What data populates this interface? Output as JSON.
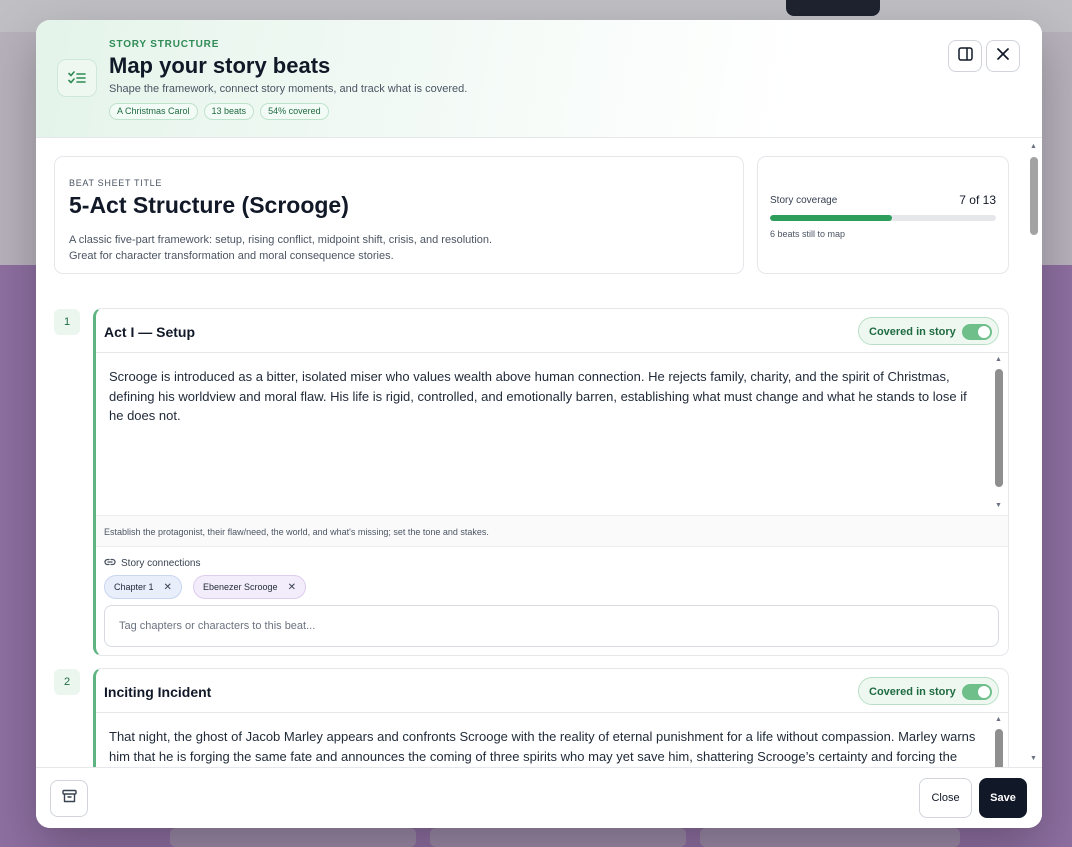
{
  "header": {
    "eyebrow": "STORY STRUCTURE",
    "title": "Map your story beats",
    "subtitle": "Shape the framework, connect story moments, and track what is covered.",
    "chips": [
      "A Christmas Carol",
      "13 beats",
      "54% covered"
    ],
    "icon": "checklist-icon",
    "actions": [
      "panel-layout-icon",
      "close-icon"
    ]
  },
  "sheet": {
    "label": "BEAT SHEET TITLE",
    "title": "5-Act Structure (Scrooge)",
    "description_line1": "A classic five-part framework: setup, rising conflict, midpoint shift, crisis, and resolution.",
    "description_line2": "Great for character transformation and moral consequence stories."
  },
  "coverage": {
    "label": "Story coverage",
    "count": "7 of 13",
    "fraction": 0.54,
    "note": "6 beats still to map"
  },
  "beats": [
    {
      "number": "1",
      "title": "Act I — Setup",
      "covered_label": "Covered in story",
      "covered": true,
      "text": "Scrooge is introduced as a bitter, isolated miser who values wealth above human connection. He rejects family, charity, and the spirit of Christmas, defining his worldview and moral flaw. His life is rigid, controlled, and emotionally barren, establishing what must change and what he stands to lose if he does not.",
      "hint": "Establish the protagonist, their flaw/need, the world, and what's missing; set the tone and stakes.",
      "connections_label": "Story connections",
      "tags": [
        {
          "label": "Chapter 1",
          "kind": "chapter"
        },
        {
          "label": "Ebenezer Scrooge",
          "kind": "character"
        }
      ],
      "tag_placeholder": "Tag chapters or characters to this beat..."
    },
    {
      "number": "2",
      "title": "Inciting Incident",
      "covered_label": "Covered in story",
      "covered": true,
      "text": "That night, the ghost of Jacob Marley appears and confronts Scrooge with the reality of eternal punishment for a life without compassion. Marley warns him that he is forging the same fate and announces the coming of three spirits who may yet save him, shattering Scrooge’s certainty and forcing the possibility of change into his closed world."
    }
  ],
  "footer": {
    "archive_icon": "archive-icon",
    "close_label": "Close",
    "save_label": "Save"
  },
  "colors": {
    "accent": "#2e9e5b",
    "primary_button": "#111827",
    "backdrop": "#8e6fa1"
  }
}
